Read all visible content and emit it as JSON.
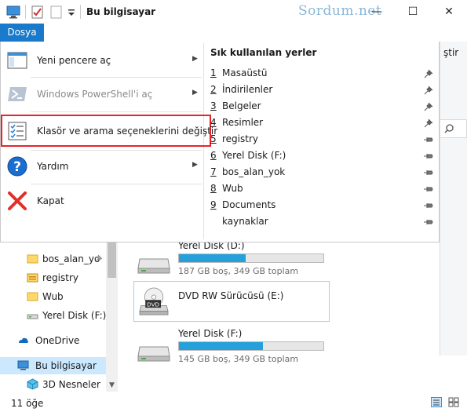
{
  "window": {
    "title": "Bu bilgisayar",
    "watermark": "Sordum.net",
    "minimize_glyph": "—",
    "maximize_glyph": "☐",
    "close_glyph": "✕"
  },
  "ribbon": {
    "file_tab": "Dosya",
    "right_peek": "ştir"
  },
  "file_menu": {
    "items": [
      {
        "label": "Yeni pencere aç",
        "icon": "new-window-icon",
        "has_submenu": true,
        "enabled": true
      },
      {
        "label": "Windows PowerShell'i aç",
        "icon": "powershell-icon",
        "has_submenu": true,
        "enabled": false
      },
      {
        "label": "Klasör ve arama seçeneklerini değiştir",
        "icon": "folder-options-icon",
        "has_submenu": false,
        "enabled": true
      },
      {
        "label": "Yardım",
        "icon": "help-icon",
        "has_submenu": true,
        "enabled": true
      },
      {
        "label": "Kapat",
        "icon": "close-x-icon",
        "has_submenu": false,
        "enabled": true
      }
    ],
    "arrow": "▶"
  },
  "recent_places": {
    "title": "Sık kullanılan yerler",
    "items": [
      {
        "num": "1",
        "name": "Masaüstü",
        "pinned": true
      },
      {
        "num": "2",
        "name": "İndirilenler",
        "pinned": true
      },
      {
        "num": "3",
        "name": "Belgeler",
        "pinned": true
      },
      {
        "num": "4",
        "name": "Resimler",
        "pinned": true
      },
      {
        "num": "5",
        "name": "registry",
        "pinned": false
      },
      {
        "num": "6",
        "name": "Yerel Disk (F:)",
        "pinned": false
      },
      {
        "num": "7",
        "name": "bos_alan_yok",
        "pinned": false
      },
      {
        "num": "8",
        "name": "Wub",
        "pinned": false
      },
      {
        "num": "9",
        "name": "Documents",
        "pinned": false
      },
      {
        "num": "",
        "name": "kaynaklar",
        "pinned": false
      }
    ]
  },
  "nav_pane": {
    "items": [
      {
        "label": "bos_alan_yo",
        "icon": "folder-icon"
      },
      {
        "label": "registry",
        "icon": "registry-folder-icon"
      },
      {
        "label": "Wub",
        "icon": "folder-icon"
      },
      {
        "label": "Yerel Disk (F:)",
        "icon": "drive-icon"
      },
      {
        "label": "OneDrive",
        "icon": "onedrive-icon"
      },
      {
        "label": "Bu bilgisayar",
        "icon": "computer-icon"
      },
      {
        "label": "3D Nesneler",
        "icon": "3d-objects-icon"
      }
    ],
    "scroll_down": "▼"
  },
  "drives": [
    {
      "name": "Yerel Disk (D:)",
      "info": "187 GB boş, 349 GB toplam",
      "used_fraction": 0.46
    },
    {
      "name": "DVD RW Sürücüsü (E:)",
      "info": "",
      "used_fraction": null
    },
    {
      "name": "Yerel Disk (F:)",
      "info": "145 GB boş, 349 GB toplam",
      "used_fraction": 0.58
    }
  ],
  "dvd_label": "DVD",
  "status": {
    "count": "11 öğe"
  },
  "colors": {
    "accent": "#1979ca",
    "highlight": "#e8232b",
    "bar_fill": "#26a0da"
  }
}
